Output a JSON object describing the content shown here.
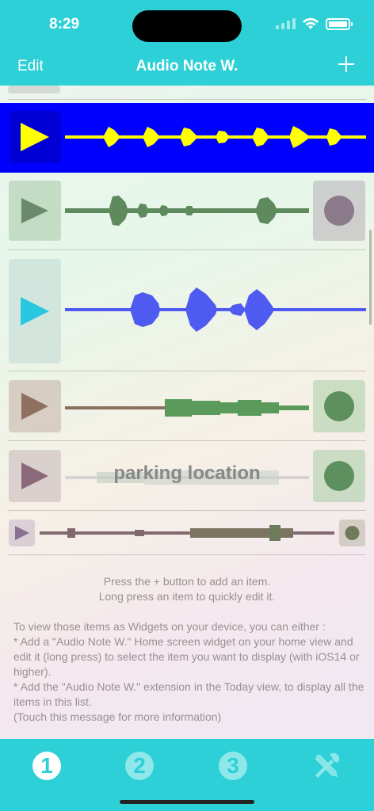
{
  "status": {
    "time": "8:29"
  },
  "nav": {
    "edit_label": "Edit",
    "title": "Audio Note W.",
    "add_icon": "plus-icon"
  },
  "list": {
    "items": [
      {
        "label": "",
        "theme": "selected",
        "colors": {
          "row_bg": "#0000ff",
          "play": "#ffff00",
          "wave": "#ffff00"
        }
      },
      {
        "label": "",
        "theme": "green",
        "colors": {
          "play": "#6b8a6b",
          "wave": "#5e8a5e",
          "stop": "#8a7a8a"
        }
      },
      {
        "label": "",
        "theme": "cyan-blue",
        "colors": {
          "play": "#28c8e0",
          "wave": "#4f5af0"
        }
      },
      {
        "label": "",
        "theme": "brown-green",
        "colors": {
          "play": "#8f6f5f",
          "wave": "#5a9a5a",
          "stop": "#5e8f5e"
        }
      },
      {
        "label": "parking location",
        "theme": "mauve",
        "colors": {
          "play": "#8a6a7a",
          "wave": "#c8c8c8",
          "stop": "#5e8f5e",
          "label_color": "#888888"
        }
      },
      {
        "label": "",
        "theme": "small",
        "colors": {
          "play": "#8a7090",
          "wave": "#806a70",
          "stop": "#6f7a5a"
        }
      }
    ]
  },
  "messages": {
    "hint_line1": "Press the + button to add an item.",
    "hint_line2": "Long press an item to quickly edit it.",
    "info_lines": [
      "To view those items as Widgets on your device, you can either :",
      "* Add a \"Audio Note W.\" Home screen widget on your home view and edit it (long press) to select the item you want to display (with iOS14 or higher).",
      "* Add the \"Audio Note W.\" extension in the Today view, to display all the items in this list.",
      "(Touch this message for more information)"
    ]
  },
  "tabs": [
    {
      "label": "1",
      "icon": "number-1-icon",
      "selected": true
    },
    {
      "label": "2",
      "icon": "number-2-icon",
      "selected": false
    },
    {
      "label": "3",
      "icon": "number-3-icon",
      "selected": false
    },
    {
      "label": "",
      "icon": "tools-icon",
      "selected": false
    }
  ]
}
